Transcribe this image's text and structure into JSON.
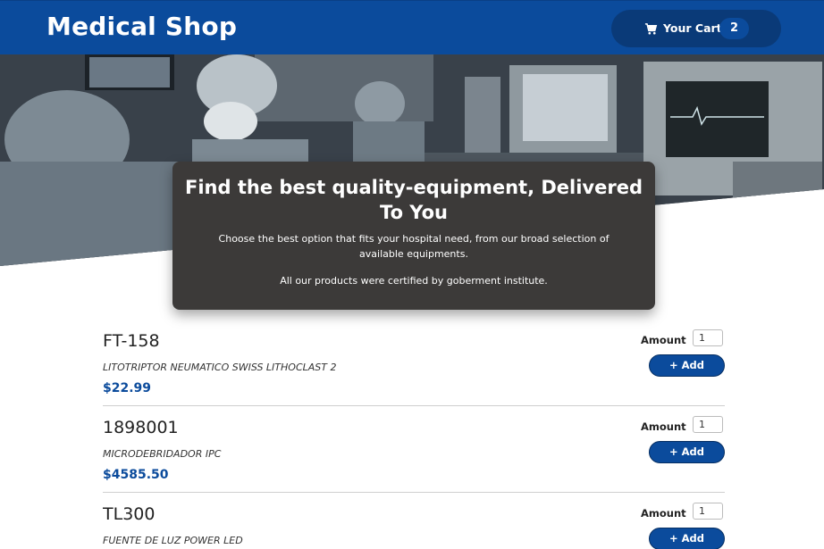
{
  "header": {
    "brand": "Medical Shop",
    "cart_label": "Your Cart",
    "cart_count": "2"
  },
  "hero": {
    "headline": "Find the best quality-equipment, Delivered To You",
    "subtext": "Choose the best option that fits your hospital need, from our broad selection of available equipments.",
    "certification": "All our products were certified by goberment institute."
  },
  "products": [
    {
      "code": "FT-158",
      "name": "LITOTRIPTOR NEUMATICO SWISS LITHOCLAST 2",
      "price": "$22.99",
      "amount_label": "Amount",
      "amount": "1",
      "add_label": "+ Add"
    },
    {
      "code": "1898001",
      "name": "MICRODEBRIDADOR IPC",
      "price": "$4585.50",
      "amount_label": "Amount",
      "amount": "1",
      "add_label": "+ Add"
    },
    {
      "code": "TL300",
      "name": "FUENTE DE LUZ POWER LED",
      "price": "",
      "amount_label": "Amount",
      "amount": "1",
      "add_label": "+ Add"
    }
  ],
  "colors": {
    "primary": "#0b4b9c",
    "cart_pill": "#0a3a78",
    "panel": "#3c3a39"
  }
}
